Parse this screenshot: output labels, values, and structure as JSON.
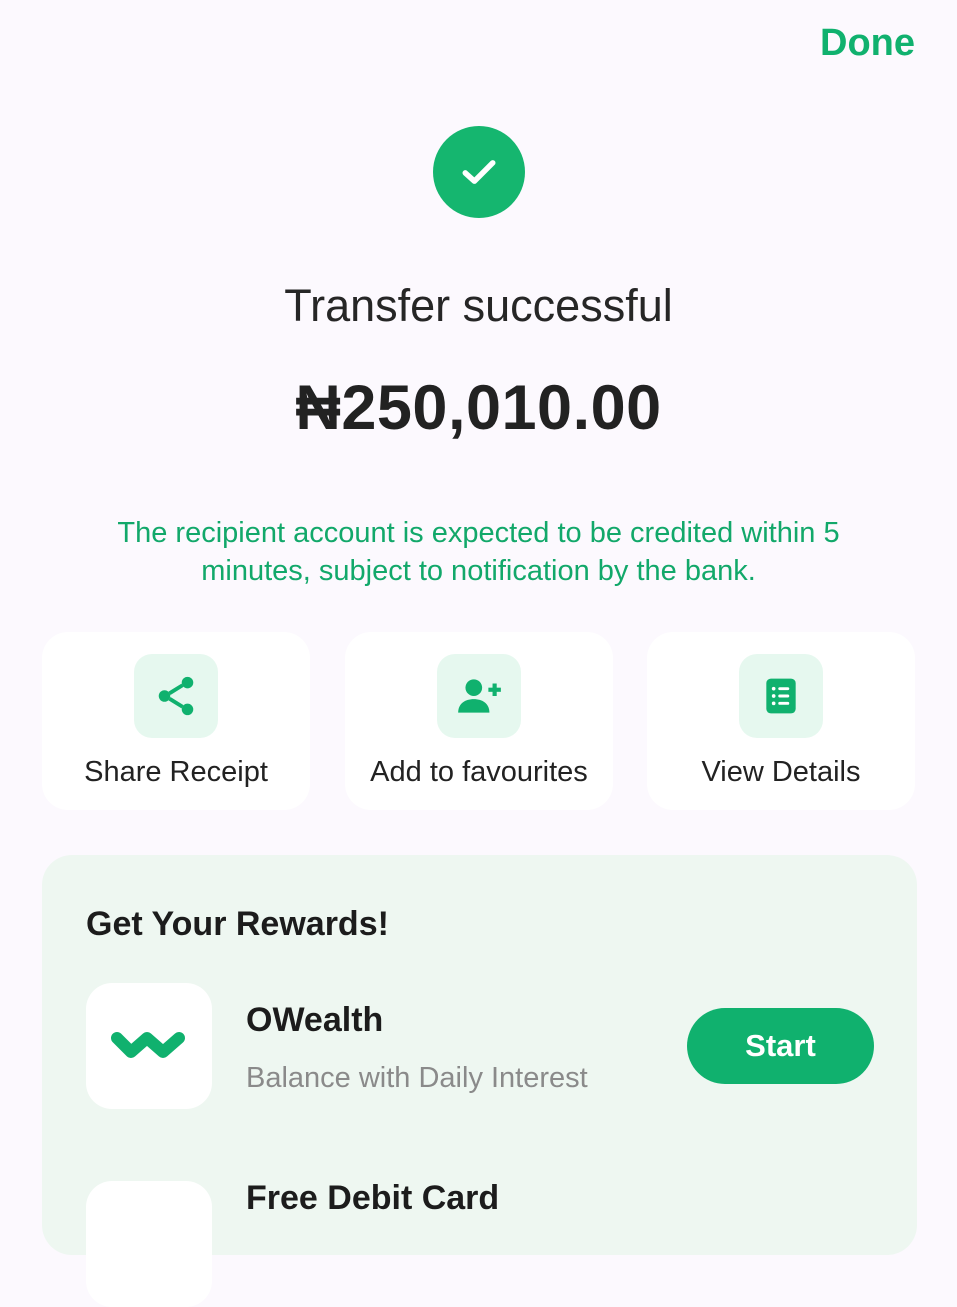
{
  "header": {
    "done_label": "Done"
  },
  "status": {
    "title": "Transfer successful",
    "amount": "₦250,010.00",
    "note": "The recipient account is expected to be credited within 5 minutes, subject to notification by the bank."
  },
  "actions": [
    {
      "label": "Share Receipt",
      "icon": "share-icon"
    },
    {
      "label": "Add to favourites",
      "icon": "add-user-icon"
    },
    {
      "label": "View Details",
      "icon": "list-icon"
    }
  ],
  "rewards": {
    "title": "Get Your Rewards!",
    "items": [
      {
        "name": "OWealth",
        "description": "Balance with Daily Interest",
        "button_label": "Start",
        "icon": "owealth-logo-icon"
      },
      {
        "name": "Free Debit Card",
        "icon": "debit-card-icon"
      }
    ]
  },
  "colors": {
    "accent": "#10B16E",
    "accent_light": "#E6F8EF",
    "background": "#FCF9FE",
    "rewards_bg": "#EEF7F1",
    "muted_text": "#8A8A8A"
  }
}
